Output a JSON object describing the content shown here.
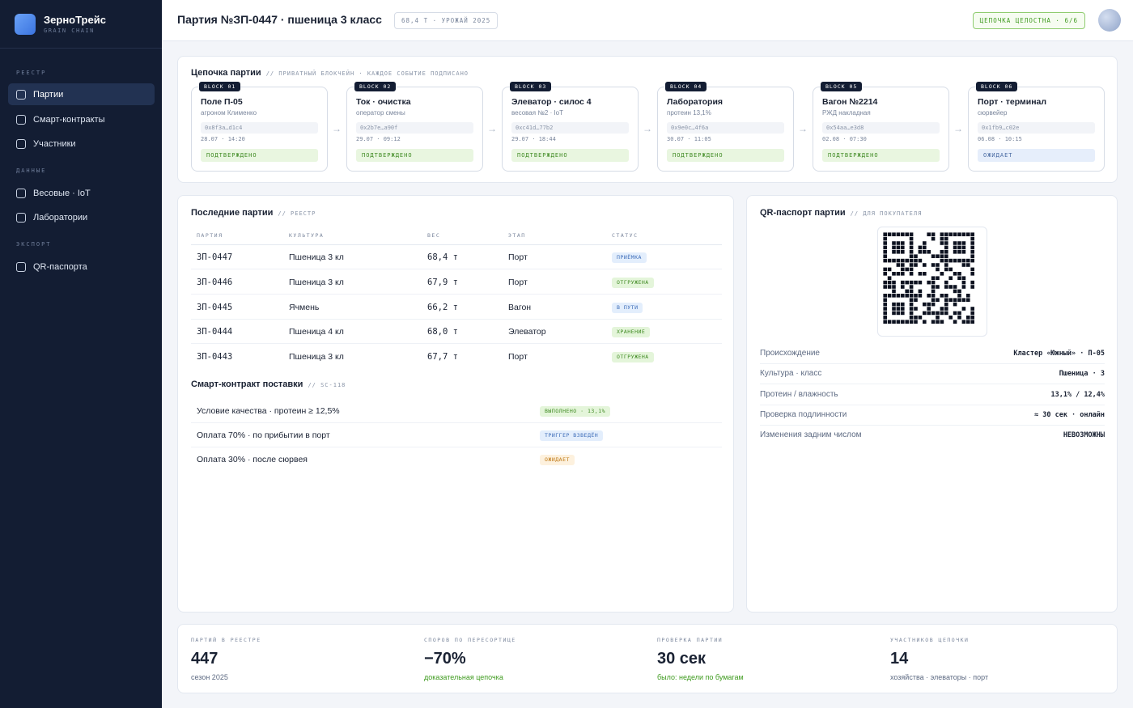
{
  "brand": {
    "name": "ЗерноТрейс",
    "sub": "GRAIN CHAIN"
  },
  "nav": {
    "sections": [
      "РЕЕСТР",
      "ДАННЫЕ",
      "ЭКСПОРТ"
    ],
    "items": [
      {
        "label": "Партии",
        "active": true
      },
      {
        "label": "Смарт-контракты"
      },
      {
        "label": "Участники"
      },
      {
        "label": "Весовые · IoT"
      },
      {
        "label": "Лаборатории"
      },
      {
        "label": "QR-паспорта"
      }
    ]
  },
  "header": {
    "title": "Партия №ЗП-0447 · пшеница 3 класс",
    "pill": "68,4 Т · УРОЖАЙ 2025",
    "chain_badge": "ЦЕПОЧКА ЦЕЛОСТНА · 6/6"
  },
  "chain": {
    "title": "Цепочка партии",
    "sub": "// ПРИВАТНЫЙ БЛОКЧЕЙН · КАЖДОЕ СОБЫТИЕ ПОДПИСАНО",
    "blocks": [
      {
        "tag": "BLOCK 01",
        "name": "Поле П-05",
        "desc": "агроном Клименко",
        "hash": "0x8f3a…d1c4",
        "time": "28.07 · 14:20",
        "status": "ПОДТВЕРЖДЕНО",
        "state": "ok"
      },
      {
        "tag": "BLOCK 02",
        "name": "Ток · очистка",
        "desc": "оператор смены",
        "hash": "0x2b7e…a90f",
        "time": "29.07 · 09:12",
        "status": "ПОДТВЕРЖДЕНО",
        "state": "ok"
      },
      {
        "tag": "BLOCK 03",
        "name": "Элеватор · силос 4",
        "desc": "весовая №2 · IoT",
        "hash": "0xc41d…77b2",
        "time": "29.07 · 18:44",
        "status": "ПОДТВЕРЖДЕНО",
        "state": "ok"
      },
      {
        "tag": "BLOCK 04",
        "name": "Лаборатория",
        "desc": "протеин 13,1%",
        "hash": "0x9e0c…4f6a",
        "time": "30.07 · 11:05",
        "status": "ПОДТВЕРЖДЕНО",
        "state": "ok"
      },
      {
        "tag": "BLOCK 05",
        "name": "Вагон №2214",
        "desc": "РЖД накладная",
        "hash": "0x54aa…e3d8",
        "time": "02.08 · 07:30",
        "status": "ПОДТВЕРЖДЕНО",
        "state": "ok"
      },
      {
        "tag": "BLOCK 06",
        "name": "Порт · терминал",
        "desc": "сюрвейер",
        "hash": "0x1fb9…c02e",
        "time": "06.08 · 10:15",
        "status": "ОЖИДАЕТ",
        "state": "wait"
      }
    ]
  },
  "batches": {
    "title": "Последние партии",
    "sub": "// РЕЕСТР",
    "columns": [
      "ПАРТИЯ",
      "КУЛЬТУРА",
      "ВЕС",
      "ЭТАП",
      "СТАТУС"
    ],
    "rows": [
      {
        "id": "ЗП-0447",
        "crop": "Пшеница 3 кл",
        "weight": "68,4 т",
        "stage": "Порт",
        "status": "ПРИЁМКА",
        "color": "blue"
      },
      {
        "id": "ЗП-0446",
        "crop": "Пшеница 3 кл",
        "weight": "67,9 т",
        "stage": "Порт",
        "status": "ОТГРУЖЕНА",
        "color": "green"
      },
      {
        "id": "ЗП-0445",
        "crop": "Ячмень",
        "weight": "66,2 т",
        "stage": "Вагон",
        "status": "В ПУТИ",
        "color": "blue"
      },
      {
        "id": "ЗП-0444",
        "crop": "Пшеница 4 кл",
        "weight": "68,0 т",
        "stage": "Элеватор",
        "status": "ХРАНЕНИЕ",
        "color": "green"
      },
      {
        "id": "ЗП-0443",
        "crop": "Пшеница 3 кл",
        "weight": "67,7 т",
        "stage": "Порт",
        "status": "ОТГРУЖЕНА",
        "color": "green"
      }
    ]
  },
  "contract": {
    "title": "Смарт-контракт поставки",
    "sub": "// SC-118",
    "rows": [
      {
        "label": "Условие качества · протеин ≥ 12,5%",
        "status": "ВЫПОЛНЕНО · 13,1%",
        "color": "green"
      },
      {
        "label": "Оплата 70% · по прибытии в порт",
        "status": "ТРИГГЕР ВЗВЕДЁН",
        "color": "blue"
      },
      {
        "label": "Оплата 30% · после сюрвея",
        "status": "ОЖИДАЕТ",
        "color": "orange"
      }
    ]
  },
  "passport": {
    "title": "QR-паспорт партии",
    "sub": "// ДЛЯ ПОКУПАТЕЛЯ",
    "rows": [
      {
        "label": "Происхождение",
        "value": "Кластер «Южный» · П-05"
      },
      {
        "label": "Культура · класс",
        "value": "Пшеница · 3"
      },
      {
        "label": "Протеин / влажность",
        "value": "13,1% / 12,4%"
      },
      {
        "label": "Проверка подлинности",
        "value": "≈ 30 сек · онлайн"
      },
      {
        "label": "Изменения задним числом",
        "value": "НЕВОЗМОЖНЫ"
      }
    ]
  },
  "stats": [
    {
      "label": "ПАРТИЙ В РЕЕСТРЕ",
      "value": "447",
      "note": "сезон 2025",
      "accent": false
    },
    {
      "label": "СПОРОВ ПО ПЕРЕСОРТИЦЕ",
      "value": "−70%",
      "note": "доказательная цепочка",
      "accent": true
    },
    {
      "label": "ПРОВЕРКА ПАРТИИ",
      "value": "30 сек",
      "note": "было: недели по бумагам",
      "accent": true
    },
    {
      "label": "УЧАСТНИКОВ ЦЕПОЧКИ",
      "value": "14",
      "note": "хозяйства · элеваторы · порт",
      "accent": false
    }
  ]
}
